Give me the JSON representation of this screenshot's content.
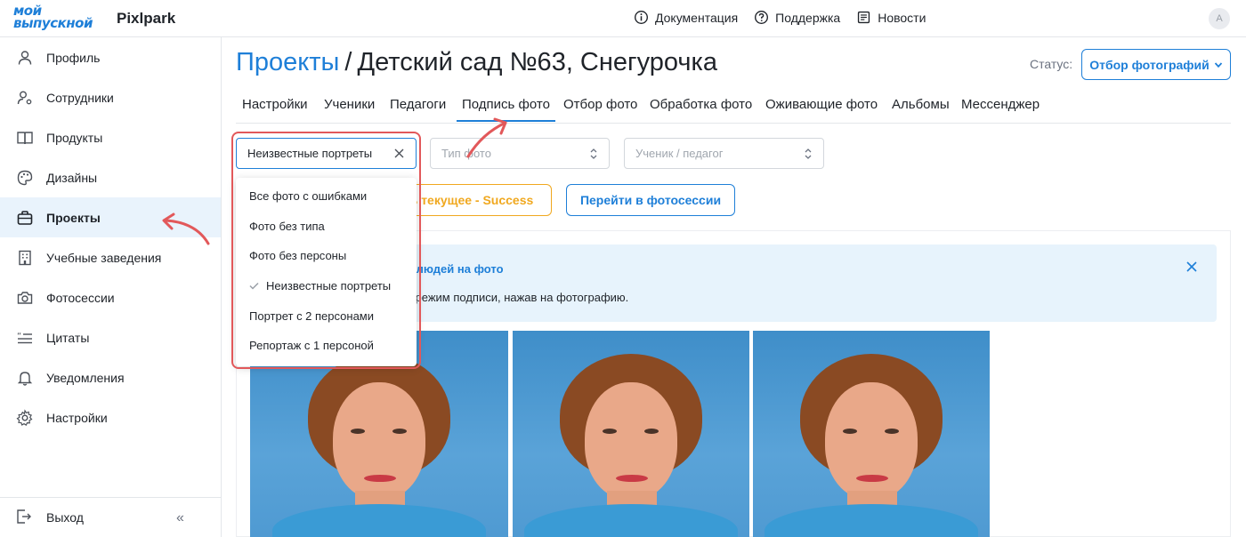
{
  "header": {
    "logo_line1": "мой",
    "logo_line2": "выпускной",
    "brand": "Pixlpark",
    "links": [
      {
        "label": "Документация",
        "icon": "info-circle-icon"
      },
      {
        "label": "Поддержка",
        "icon": "help-circle-icon"
      },
      {
        "label": "Новости",
        "icon": "newspaper-icon"
      }
    ],
    "avatar_initial": "A"
  },
  "sidebar": {
    "items": [
      {
        "label": "Профиль",
        "icon": "user-icon"
      },
      {
        "label": "Сотрудники",
        "icon": "user-gear-icon"
      },
      {
        "label": "Продукты",
        "icon": "book-icon"
      },
      {
        "label": "Дизайны",
        "icon": "palette-icon"
      },
      {
        "label": "Проекты",
        "icon": "briefcase-icon"
      },
      {
        "label": "Учебные заведения",
        "icon": "building-icon"
      },
      {
        "label": "Фотосессии",
        "icon": "camera-icon"
      },
      {
        "label": "Цитаты",
        "icon": "quote-icon"
      },
      {
        "label": "Уведомления",
        "icon": "bell-icon"
      },
      {
        "label": "Настройки",
        "icon": "gear-icon"
      }
    ],
    "active_index": 4,
    "logout_label": "Выход",
    "collapse_symbol": "«"
  },
  "page": {
    "breadcrumb": "Проекты",
    "separator": "/",
    "title": "Детский сад №63, Снегурочка",
    "status_label": "Статус:",
    "status_value": "Отбор фотографий"
  },
  "tabs": [
    "Настройки",
    "Ученики",
    "Педагоги",
    "Подпись фото",
    "Отбор фото",
    "Обработка фото",
    "Оживающие фото",
    "Альбомы",
    "Мессенджер"
  ],
  "active_tab": 3,
  "filters": {
    "selected": "Неизвестные портреты",
    "type_placeholder": "Тип фото",
    "person_placeholder": "Ученик / педагог",
    "options": [
      "Все фото с ошибками",
      "Фото без типа",
      "Фото без персоны",
      "Неизвестные портреты",
      "Портрет с 2 персонами",
      "Репортаж с 1 персоной"
    ],
    "checked_index": 3
  },
  "buttons": {
    "yellow_label": "ь текущее - Success",
    "blue_label": "Перейти в фотосессии"
  },
  "notice": {
    "title_fragment": "ь людей на фото",
    "body_fragment": "в режим подписи, нажав на фотографию."
  },
  "colors": {
    "accent": "#1e7fd8",
    "warning": "#f0a81f",
    "highlight": "#e2585a"
  }
}
